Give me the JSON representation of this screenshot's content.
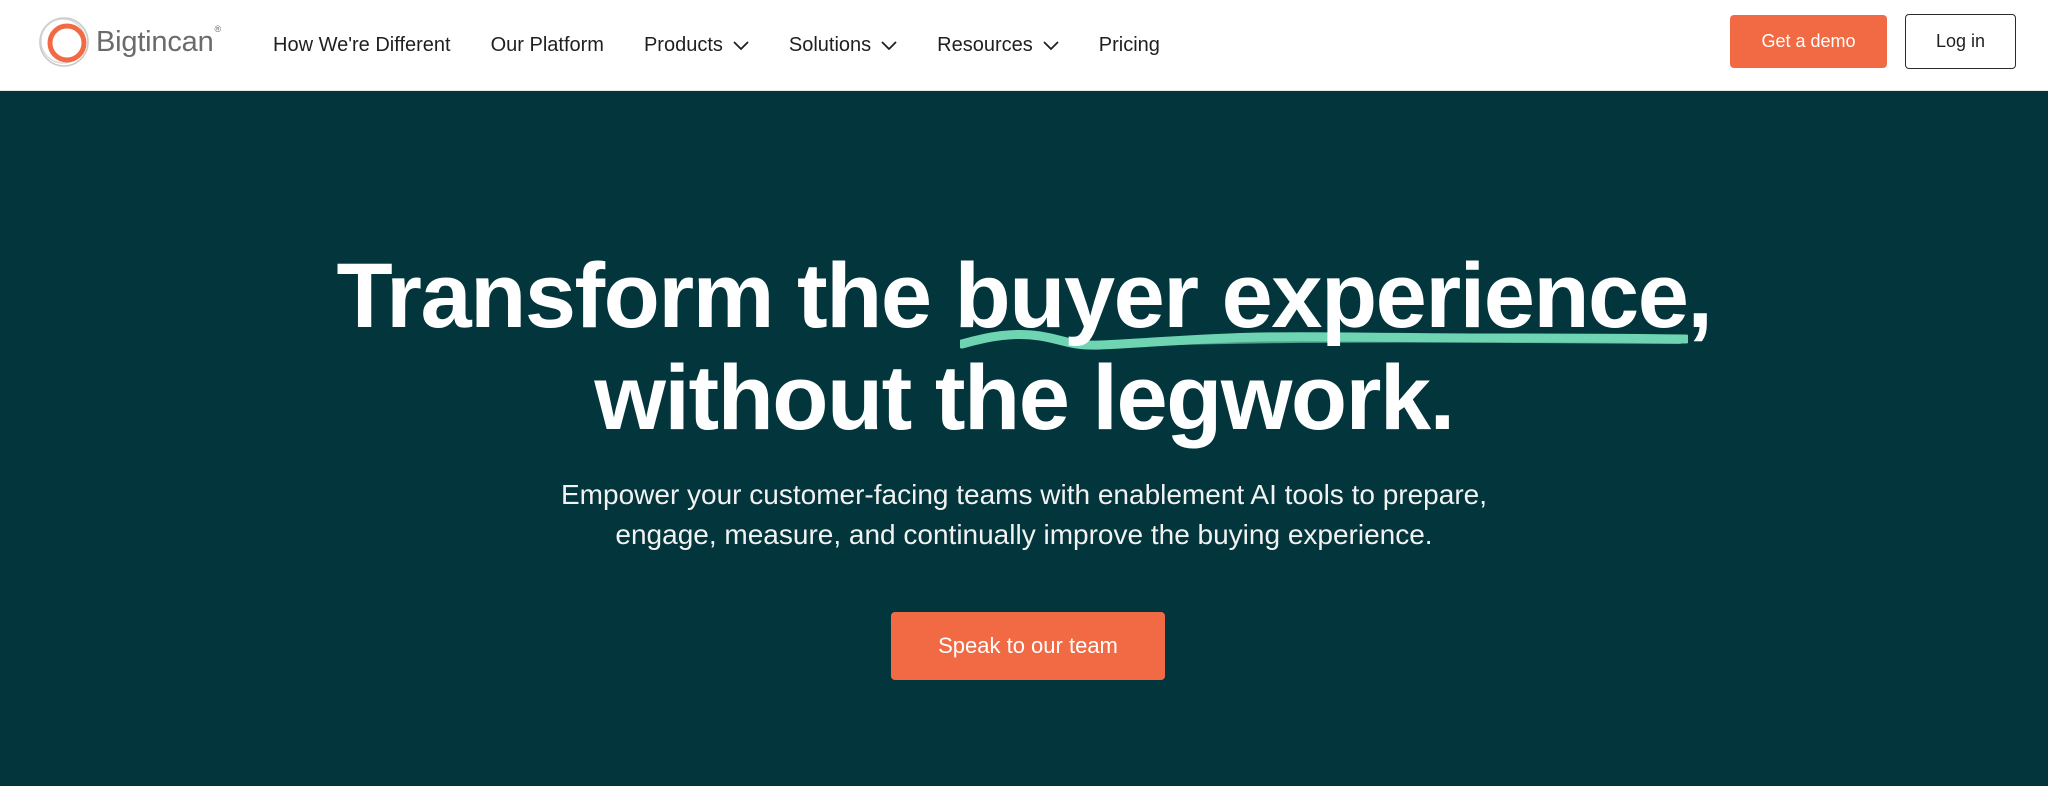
{
  "brand": {
    "name": "Bigtincan",
    "registered_mark": "®",
    "logo_icon": "bigtincan-circle-logo",
    "colors": {
      "accent": "#f26a44",
      "hero_background": "#02363c",
      "underline": "#6fd4b2",
      "logo_ring_outer": "#c9c9c9",
      "logo_ring_inner": "#f26a44"
    }
  },
  "nav": {
    "items": [
      {
        "label": "How We're Different",
        "has_dropdown": false
      },
      {
        "label": "Our Platform",
        "has_dropdown": false
      },
      {
        "label": "Products",
        "has_dropdown": true,
        "icon": "chevron-down-icon"
      },
      {
        "label": "Solutions",
        "has_dropdown": true,
        "icon": "chevron-down-icon"
      },
      {
        "label": "Resources",
        "has_dropdown": true,
        "icon": "chevron-down-icon"
      },
      {
        "label": "Pricing",
        "has_dropdown": false
      }
    ]
  },
  "header_actions": {
    "demo_label": "Get a demo",
    "login_label": "Log in"
  },
  "hero": {
    "headline_line1": "Transform the buyer experience,",
    "headline_line2": "without the legwork.",
    "highlight_phrase": "buyer experience,",
    "subtext_line1": "Empower your customer-facing teams with enablement AI tools to prepare,",
    "subtext_line2": "engage, measure, and continually improve the buying experience.",
    "cta_label": "Speak to our team"
  }
}
